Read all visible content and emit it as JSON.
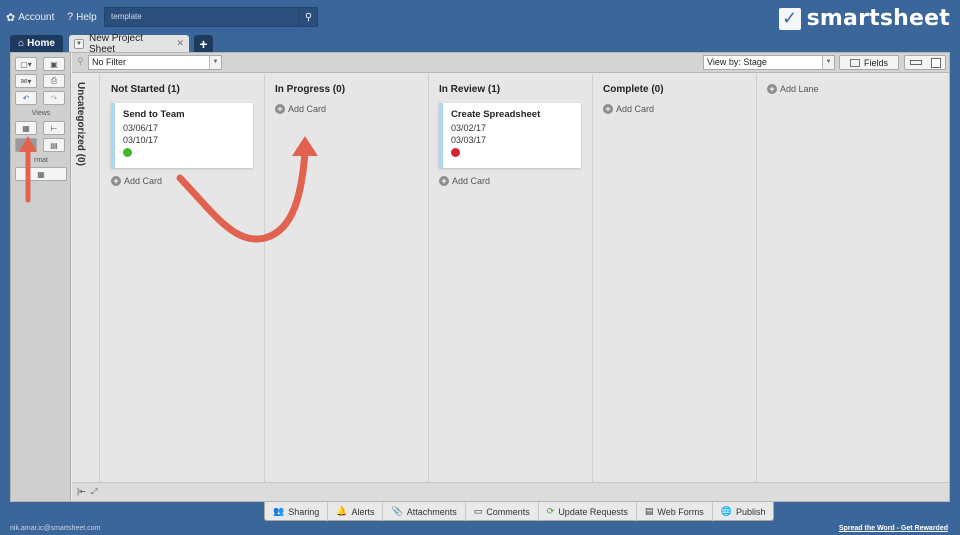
{
  "topbar": {
    "account_label": "Account",
    "help_label": "Help",
    "search_value": "template",
    "logo_text": "smartsheet"
  },
  "tabs": {
    "home_label": "Home",
    "sheet_label": "New Project Sheet"
  },
  "leftbar": {
    "views_label": "Views",
    "format_label": "rmat"
  },
  "filterbar": {
    "filter_value": "No Filter",
    "viewby_value": "View by: Stage",
    "fields_label": "Fields"
  },
  "board": {
    "uncategorized_label": "Uncategorized (0)",
    "lanes": [
      {
        "title": "Not Started (1)",
        "add_label": "Add Card",
        "cards": [
          {
            "title": "Send to Team",
            "date1": "03/06/17",
            "date2": "03/10/17",
            "status_color": "#44b72d"
          }
        ]
      },
      {
        "title": "In Progress (0)",
        "add_label": "Add Card",
        "cards": []
      },
      {
        "title": "In Review (1)",
        "add_label": "Add Card",
        "cards": [
          {
            "title": "Create Spreadsheet",
            "date1": "03/02/17",
            "date2": "03/03/17",
            "status_color": "#d6202e"
          }
        ]
      },
      {
        "title": "Complete (0)",
        "add_label": "Add Card",
        "cards": []
      }
    ],
    "add_lane_label": "Add Lane"
  },
  "bottombar": {
    "sharing": "Sharing",
    "alerts": "Alerts",
    "attachments": "Attachments",
    "comments": "Comments",
    "update_requests": "Update Requests",
    "web_forms": "Web Forms",
    "publish": "Publish"
  },
  "footer": {
    "email": "nik.amar.ic@smartsheet.com",
    "promo": "Spread the Word - Get Rewarded"
  },
  "colors": {
    "background": "#3b6699",
    "annotation_arrow": "#e0624f",
    "card_accent": "#a9d6f0"
  }
}
